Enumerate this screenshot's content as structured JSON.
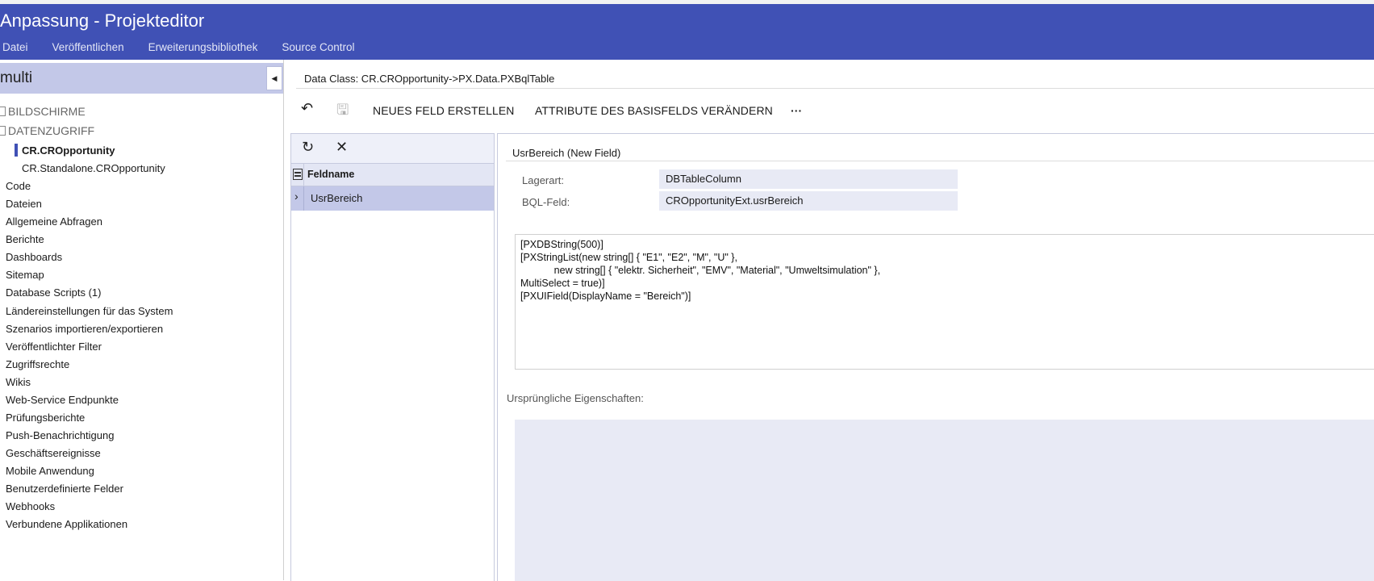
{
  "header": {
    "title": "Anpassung - Projekteditor",
    "menu": [
      "Datei",
      "Veröffentlichen",
      "Erweiterungsbibliothek",
      "Source Control"
    ]
  },
  "project": {
    "name": "multi",
    "collapse_icon": "caret-left-icon"
  },
  "tree": {
    "groups": [
      "BILDSCHIRME",
      "DATENZUGRIFF"
    ],
    "children": [
      "CR.CROpportunity",
      "CR.Standalone.CROpportunity"
    ],
    "selected": "CR.CROpportunity",
    "items": [
      "Code",
      "Dateien",
      "Allgemeine Abfragen",
      "Berichte",
      "Dashboards",
      "Sitemap",
      "Database Scripts (1)",
      "Ländereinstellungen für das System",
      "Szenarios importieren/exportieren",
      "Veröffentlichter Filter",
      "Zugriffsrechte",
      "Wikis",
      "Web-Service Endpunkte",
      "Prüfungsberichte",
      "Push-Benachrichtigung",
      "Geschäftsereignisse",
      "Mobile Anwendung",
      "Benutzerdefinierte Felder",
      "Webhooks",
      "Verbundene Applikationen"
    ]
  },
  "content": {
    "data_class": "Data Class: CR.CROpportunity->PX.Data.PXBqlTable",
    "toolbar": {
      "undo_icon": "undo-icon",
      "save_icon": "save-icon",
      "new_field": "NEUES FELD ERSTELLEN",
      "change_attrs": "ATTRIBUTE DES BASISFELDS VERÄNDERN",
      "more": "···"
    }
  },
  "fieldlist": {
    "refresh_icon": "refresh-icon",
    "delete_icon": "close-icon",
    "column_header": "Feldname",
    "rows": [
      "UsrBereich"
    ]
  },
  "detail": {
    "title": "UsrBereich (New Field)",
    "storage_label": "Lagerart:",
    "storage_value": "DBTableColumn",
    "bql_label": "BQL-Feld:",
    "bql_value": "CROpportunityExt.usrBereich",
    "code": "[PXDBString(500)]\n[PXStringList(new string[] { \"E1\", \"E2\", \"M\", \"U\" },\n            new string[] { \"elektr. Sicherheit\", \"EMV\", \"Material\", \"Umweltsimulation\" },\nMultiSelect = true)]\n[PXUIField(DisplayName = \"Bereich\")]",
    "original_label": "Ursprüngliche Eigenschaften:"
  },
  "colors": {
    "header": "#4051b5",
    "selection": "#c3c8e8",
    "field_bg": "#e8eaf5"
  }
}
